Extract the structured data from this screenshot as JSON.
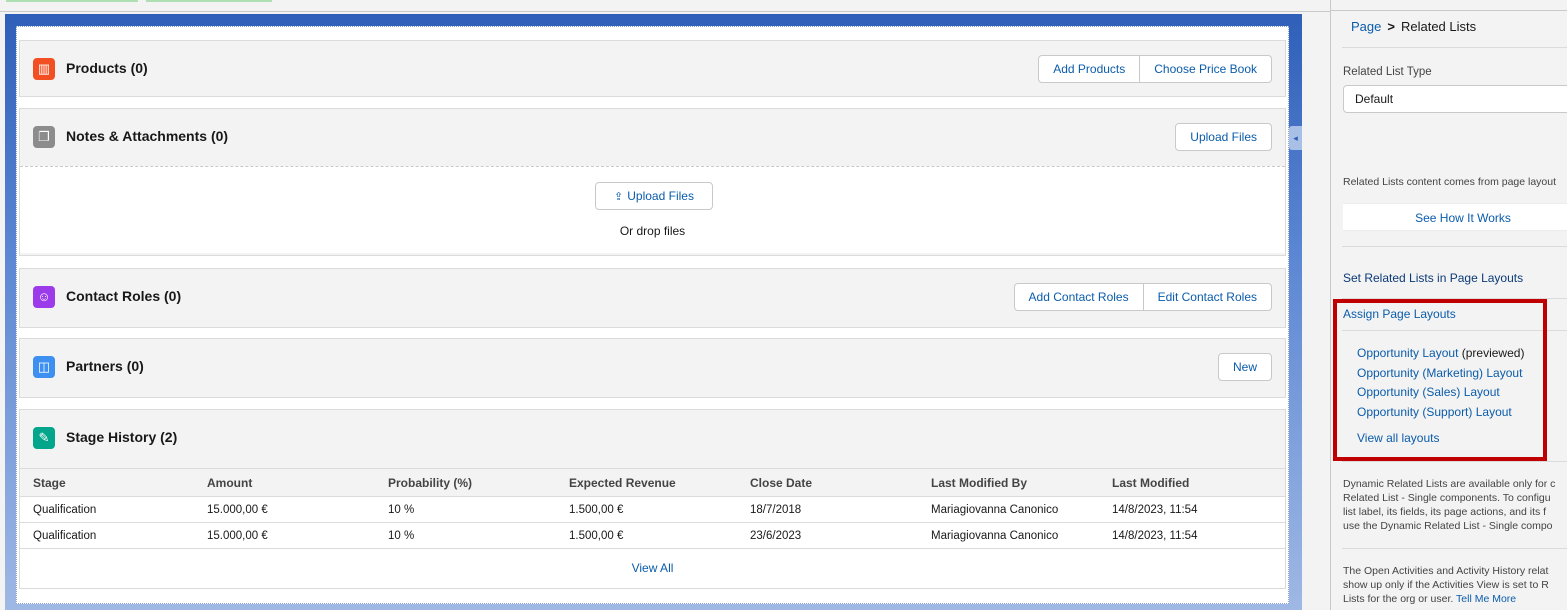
{
  "main": {
    "products": {
      "title": "Products (0)",
      "buttons": [
        "Add Products",
        "Choose Price Book"
      ]
    },
    "notes": {
      "title": "Notes & Attachments (0)",
      "button": "Upload Files",
      "upload_label": "Upload Files",
      "drop_text": "Or drop files"
    },
    "contact_roles": {
      "title": "Contact Roles (0)",
      "buttons": [
        "Add Contact Roles",
        "Edit Contact Roles"
      ]
    },
    "partners": {
      "title": "Partners (0)",
      "button": "New"
    },
    "stage_history": {
      "title": "Stage History (2)",
      "columns": [
        "Stage",
        "Amount",
        "Probability (%)",
        "Expected Revenue",
        "Close Date",
        "Last Modified By",
        "Last Modified"
      ],
      "rows": [
        [
          "Qualification",
          "15.000,00 €",
          "10 %",
          "1.500,00 €",
          "18/7/2018",
          "Mariagiovanna Canonico",
          "14/8/2023, 11:54"
        ],
        [
          "Qualification",
          "15.000,00 €",
          "10 %",
          "1.500,00 €",
          "23/6/2023",
          "Mariagiovanna Canonico",
          "14/8/2023, 11:54"
        ]
      ],
      "view_all": "View All"
    }
  },
  "panel": {
    "breadcrumb": {
      "parent": "Page",
      "separator": ">",
      "current": "Related Lists"
    },
    "related_list_type_label": "Related List Type",
    "related_list_type_value": "Default",
    "content_text": "Related Lists content comes from page layout",
    "see_how": "See How It Works",
    "set_related_lists": "Set Related Lists in Page Layouts",
    "assign_page_layouts": "Assign Page Layouts",
    "layouts": [
      {
        "name": "Opportunity Layout",
        "suffix": "(previewed)"
      },
      {
        "name": "Opportunity (Marketing) Layout",
        "suffix": ""
      },
      {
        "name": "Opportunity (Sales) Layout",
        "suffix": ""
      },
      {
        "name": "Opportunity (Support) Layout",
        "suffix": ""
      }
    ],
    "view_all_layouts": "View all layouts",
    "dynamic_text": [
      "Dynamic Related Lists are available only for c",
      "Related List - Single components. To configu",
      "list label, its fields, its page actions, and its f",
      "use the Dynamic Related List - Single compo"
    ],
    "activities_text": [
      "The Open Activities and Activity History relat",
      "show up only if the Activities View is set to R",
      "Lists for the org or user."
    ],
    "tell_me_more": "Tell Me More"
  },
  "colors": {
    "accent": "#0b5cab",
    "highlight": "#c00000",
    "products_icon": "#f25022",
    "notes_icon": "#8c8c8c",
    "contact_icon": "#9b3bea",
    "partners_icon": "#3d8ff0",
    "stage_icon": "#04a68b"
  }
}
